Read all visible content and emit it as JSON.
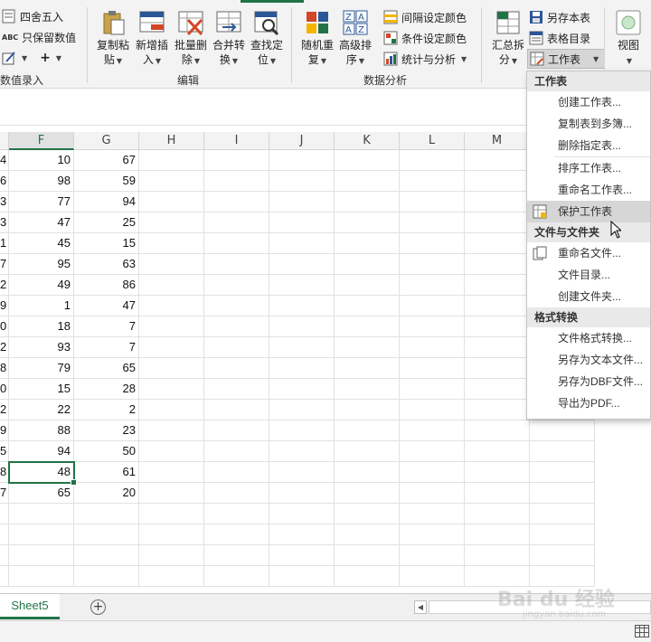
{
  "ribbon": {
    "left_group": {
      "round_label": "四舍五入",
      "keep_values_label": "只保留数值",
      "keep_values_prefix": "ABC",
      "group_label": "数值录入"
    },
    "edit_group": {
      "buttons": [
        {
          "label1": "复制粘",
          "label2": "贴"
        },
        {
          "label1": "新增插",
          "label2": "入"
        },
        {
          "label1": "批量删",
          "label2": "除"
        },
        {
          "label1": "合并转",
          "label2": "换"
        },
        {
          "label1": "查找定",
          "label2": "位"
        }
      ],
      "group_label": "编辑"
    },
    "analysis_group": {
      "buttons": [
        {
          "label1": "随机重",
          "label2": "复"
        },
        {
          "label1": "高级排",
          "label2": "序"
        }
      ],
      "small_items": [
        "间隔设定颜色",
        "条件设定颜色",
        "统计与分析"
      ],
      "group_label": "数据分析"
    },
    "workbook_group": {
      "summary_label1": "汇总拆",
      "summary_label2": "分",
      "save_sheet": "另存本表",
      "sheet_index": "表格目录",
      "worksheet_dropdown": "工作表"
    },
    "view_label": "视图"
  },
  "sheet": {
    "columns": [
      "F",
      "G",
      "H",
      "I",
      "J",
      "K",
      "L",
      "M"
    ],
    "selected_column": "F",
    "row_prefixes": [
      "4",
      "6",
      "3",
      "3",
      "1",
      "7",
      "2",
      "9",
      "0",
      "2",
      "8",
      "0",
      "2",
      "9",
      "5",
      "8",
      "7"
    ],
    "col_f": [
      "10",
      "98",
      "77",
      "47",
      "45",
      "95",
      "49",
      "1",
      "18",
      "93",
      "79",
      "15",
      "22",
      "88",
      "94",
      "48",
      "65"
    ],
    "col_g": [
      "67",
      "59",
      "94",
      "25",
      "15",
      "63",
      "86",
      "47",
      "7",
      "7",
      "65",
      "28",
      "2",
      "23",
      "50",
      "61",
      "20"
    ],
    "active_cell_value": "48"
  },
  "tabs": {
    "active_sheet": "Sheet5",
    "add_symbol": "+"
  },
  "menu": {
    "sections": [
      {
        "header": "工作表",
        "items": [
          "创建工作表...",
          "复制表到多簿...",
          "删除指定表...",
          "排序工作表...",
          "重命名工作表...",
          "保护工作表"
        ]
      },
      {
        "header": "文件与文件夹",
        "items": [
          "重命名文件...",
          "文件目录...",
          "创建文件夹..."
        ]
      },
      {
        "header": "格式转换",
        "items": [
          "文件格式转换...",
          "另存为文本文件...",
          "另存为DBF文件...",
          "导出为PDF..."
        ]
      }
    ],
    "hovered_item": "保护工作表"
  },
  "watermark": {
    "brand": "Bai du 经验",
    "url": "jingyan.baidu.com"
  },
  "colors": {
    "accent": "#217346",
    "ribbon_bg": "#f3f3f3",
    "hover_bg": "#d6d6d6"
  }
}
